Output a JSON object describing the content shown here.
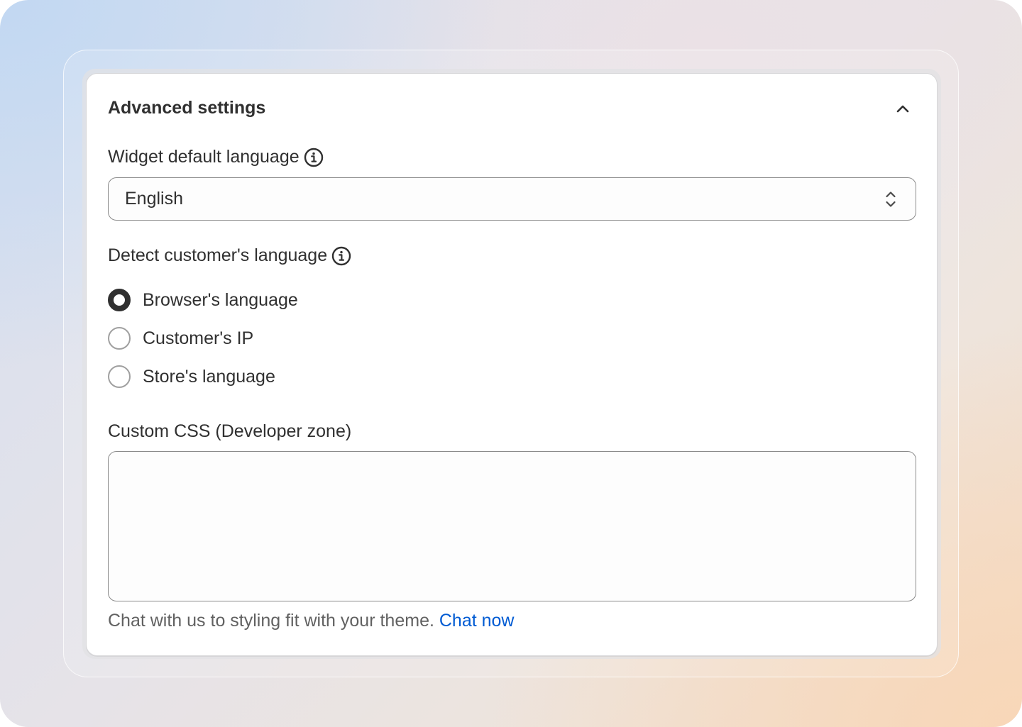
{
  "card": {
    "title": "Advanced settings",
    "collapse_icon": "chevron-up-icon"
  },
  "widget_language": {
    "label": "Widget default language",
    "info_icon": "info-icon",
    "selected_value": "English",
    "arrows_icon": "select-arrows-icon"
  },
  "detect_language": {
    "label": "Detect customer's language",
    "info_icon": "info-icon",
    "options": [
      {
        "label": "Browser's language",
        "checked": true
      },
      {
        "label": "Customer's IP",
        "checked": false
      },
      {
        "label": "Store's language",
        "checked": false
      }
    ]
  },
  "custom_css": {
    "label": "Custom CSS (Developer zone)",
    "value": "",
    "help_text": "Chat with us to styling fit with your theme.",
    "help_link": "Chat now"
  },
  "colors": {
    "text": "#303030",
    "link": "#005bd3",
    "radio_checked": "#303030",
    "border": "#8a8a8a"
  }
}
